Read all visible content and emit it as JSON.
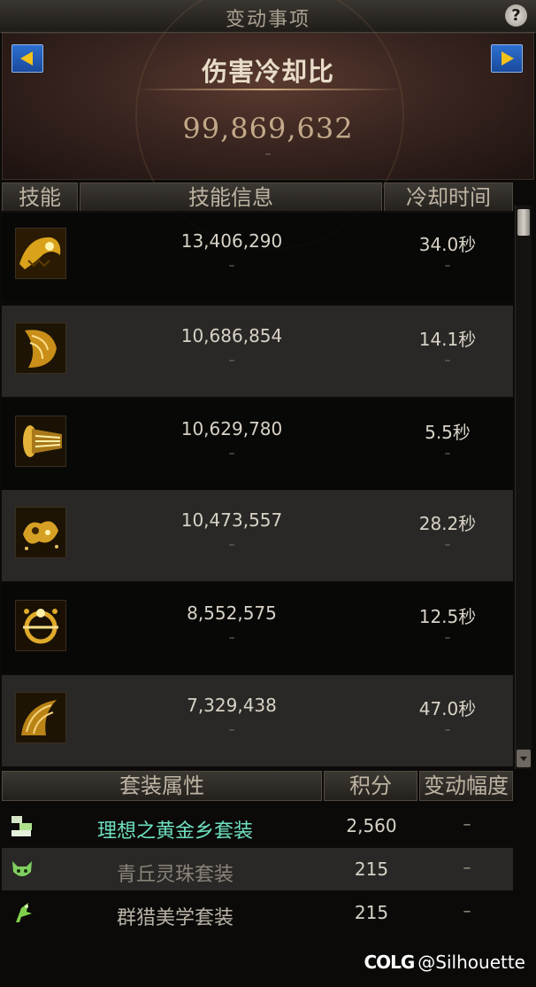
{
  "window": {
    "title": "变动事项",
    "help_icon": "question-icon",
    "help_label": "?"
  },
  "header": {
    "stat_title": "伤害冷却比",
    "stat_value": "99,869,632",
    "stat_change": "–",
    "prev_icon": "left-arrow-icon",
    "next_icon": "right-arrow-icon"
  },
  "skill_table": {
    "columns": [
      "技能",
      "技能信息",
      "冷却时间"
    ],
    "rows": [
      {
        "icon": "skill-icon-1",
        "damage": "13,406,290",
        "damage_change": "–",
        "cooldown": "34.0秒",
        "cooldown_change": "–"
      },
      {
        "icon": "skill-icon-2",
        "damage": "10,686,854",
        "damage_change": "–",
        "cooldown": "14.1秒",
        "cooldown_change": "–"
      },
      {
        "icon": "skill-icon-3",
        "damage": "10,629,780",
        "damage_change": "–",
        "cooldown": "5.5秒",
        "cooldown_change": "–"
      },
      {
        "icon": "skill-icon-4",
        "damage": "10,473,557",
        "damage_change": "–",
        "cooldown": "28.2秒",
        "cooldown_change": "–"
      },
      {
        "icon": "skill-icon-5",
        "damage": "8,552,575",
        "damage_change": "–",
        "cooldown": "12.5秒",
        "cooldown_change": "–"
      },
      {
        "icon": "skill-icon-6",
        "damage": "7,329,438",
        "damage_change": "–",
        "cooldown": "47.0秒",
        "cooldown_change": "–"
      }
    ]
  },
  "set_table": {
    "columns": [
      "套装属性",
      "积分",
      "变动幅度"
    ],
    "rows": [
      {
        "icon": "gold-set-icon",
        "name": "理想之黄金乡套装",
        "score": "2,560",
        "change": "–",
        "color": "#6fe0c0"
      },
      {
        "icon": "fox-set-icon",
        "name": "青丘灵珠套装",
        "score": "215",
        "change": "–",
        "color": "#8a847a"
      },
      {
        "icon": "hunt-set-icon",
        "name": "群猎美学套装",
        "score": "215",
        "change": "–",
        "color": "#b9b2a6"
      }
    ]
  },
  "watermark": {
    "logo": "COLG",
    "handle": "@Silhouette"
  }
}
